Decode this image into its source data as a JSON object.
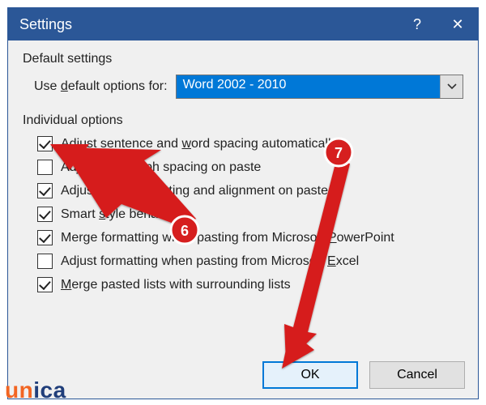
{
  "window": {
    "title": "Settings",
    "help": "?",
    "close": "✕"
  },
  "default_group": {
    "label": "Default settings",
    "field_prefix": "Use ",
    "field_uchar": "d",
    "field_suffix": "efault options for:",
    "select_value": "Word 2002 - 2010"
  },
  "individual_group": {
    "label": "Individual options",
    "items": [
      {
        "checked": true,
        "pre": "Adjust sentence and ",
        "u": "w",
        "post": "ord spacing automatically"
      },
      {
        "checked": false,
        "pre": "Adjust paragraph spacing on paste",
        "u": "",
        "post": ""
      },
      {
        "checked": true,
        "pre": "Adjust t",
        "u": "a",
        "post": "ble formatting and alignment on paste"
      },
      {
        "checked": true,
        "pre": "Smart ",
        "u": "s",
        "post": "tyle behavior"
      },
      {
        "checked": true,
        "pre": "Merge formatting when pasting from Microsoft ",
        "u": "P",
        "post": "owerPoint"
      },
      {
        "checked": false,
        "pre": "Adjust formatting when pasting from Microsoft ",
        "u": "E",
        "post": "xcel"
      },
      {
        "checked": true,
        "pre": "",
        "u": "M",
        "post": "erge pasted lists with surrounding lists"
      }
    ]
  },
  "buttons": {
    "ok": "OK",
    "cancel": "Cancel"
  },
  "annotations": {
    "badge6": "6",
    "badge7": "7"
  },
  "watermark": {
    "a": "un",
    "b": "ica"
  }
}
